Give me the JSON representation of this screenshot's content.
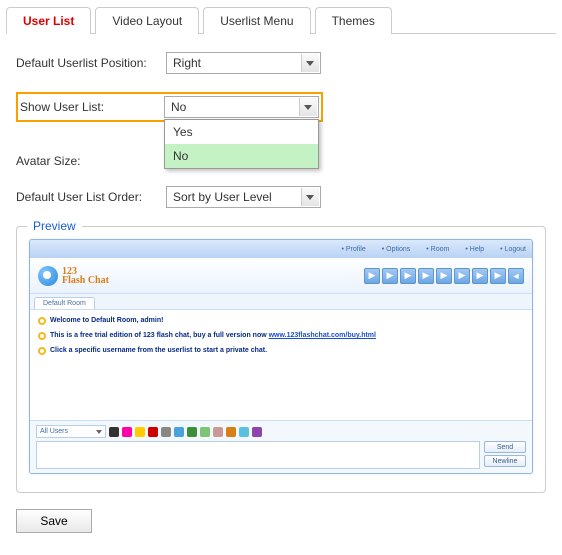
{
  "tabs": {
    "user_list": "User List",
    "video_layout": "Video Layout",
    "userlist_menu": "Userlist Menu",
    "themes": "Themes"
  },
  "form": {
    "default_position_label": "Default Userlist Position:",
    "default_position_value": "Right",
    "show_userlist_label": "Show User List:",
    "show_userlist_value": "No",
    "show_userlist_options": {
      "yes": "Yes",
      "no": "No"
    },
    "avatar_size_label": "Avatar Size:",
    "sort_order_label": "Default User List Order:",
    "sort_order_value": "Sort by User Level"
  },
  "preview": {
    "legend": "Preview",
    "titlebar": {
      "a": "Profile",
      "b": "Options",
      "c": "Room",
      "d": "Help",
      "e": "Logout"
    },
    "logo_line1": "123",
    "logo_line2": "Flash Chat",
    "room_tab": "Default Room",
    "line1": "Welcome to Default Room, admin!",
    "line2_a": "This is a free trial edition of 123 flash chat, buy a full version now ",
    "line2_link": "www.123flashchat.com/buy.html",
    "line3": "Click a specific username from the userlist to start a private chat.",
    "all_users": "All Users",
    "send": "Send",
    "newline": "Newline"
  },
  "save": "Save"
}
